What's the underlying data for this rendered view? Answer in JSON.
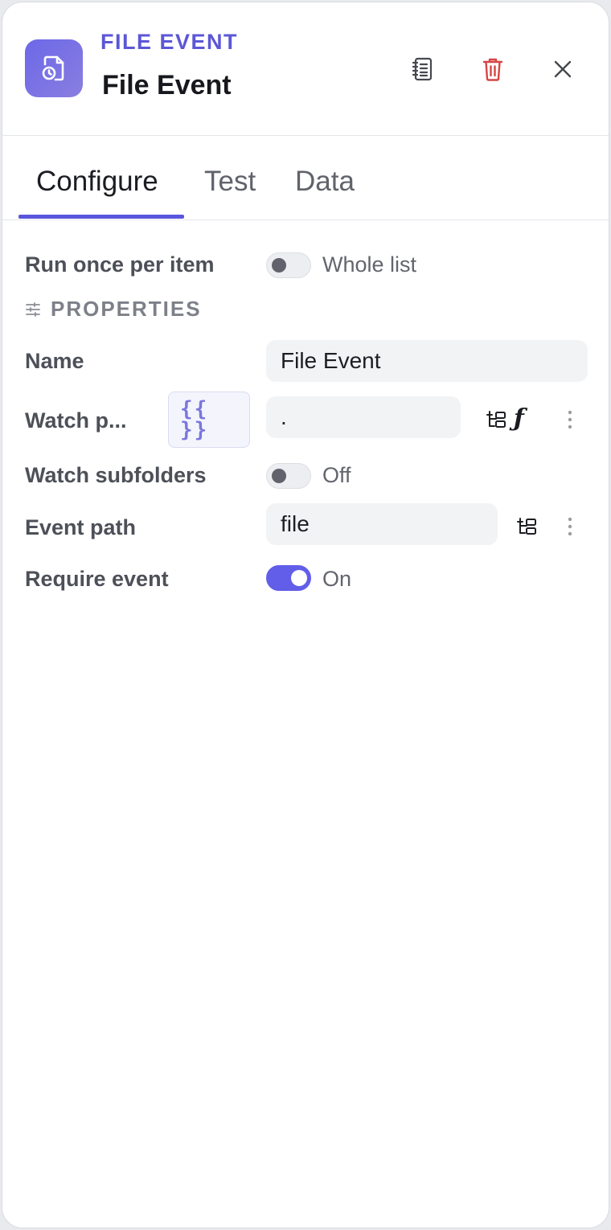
{
  "header": {
    "kind": "FILE EVENT",
    "title": "File Event",
    "icons": [
      "file-clock-icon",
      "notebook-icon",
      "trash-icon",
      "close-icon"
    ],
    "accent": "#5b57d6",
    "danger": "#d64545"
  },
  "tabs": [
    {
      "label": "Configure",
      "active": true
    },
    {
      "label": "Test",
      "active": false
    },
    {
      "label": "Data",
      "active": false
    }
  ],
  "run_mode": {
    "label": "Run once per item",
    "state": "Whole list",
    "on": false
  },
  "properties": {
    "section_label": "PROPERTIES",
    "name": {
      "label": "Name",
      "value": "File Event"
    },
    "watch_path": {
      "label": "Watch p...",
      "value": ".",
      "expr_label": "{{ }}"
    },
    "watch_subfolders": {
      "label": "Watch subfolders",
      "state": "Off",
      "on": false
    },
    "event_path": {
      "label": "Event path",
      "value": "file"
    },
    "require_event": {
      "label": "Require event",
      "state": "On",
      "on": true
    }
  }
}
